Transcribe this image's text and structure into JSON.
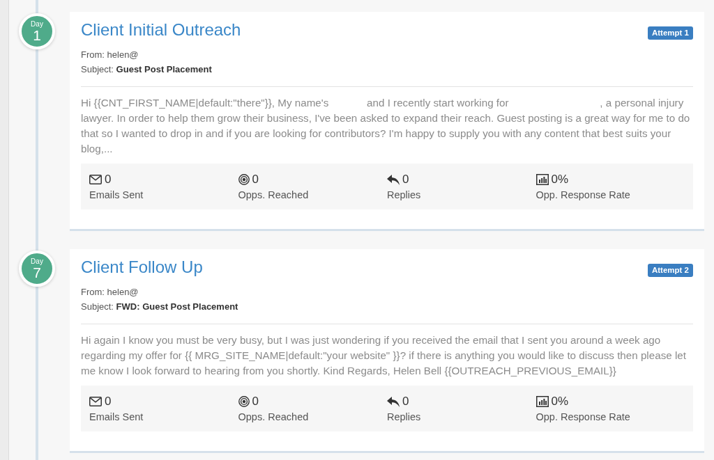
{
  "steps": [
    {
      "day_label": "Day",
      "day": "1",
      "title": "Client Initial Outreach",
      "badge": "Attempt 1",
      "from_line": "From: helen@",
      "subject_line": "Subject: **Guest Post Placement**",
      "body": "Hi {{CNT_FIRST_NAME|default:\"there\"}}, My name's             and I recently start working for                               , a personal injury lawyer. In order to help them grow their business, I've been asked to expand their reach. Guest posting is a great way for me to do that so I wanted to drop in and if you are looking for contributors? I'm happy to supply you with any content that best suits your blog,...",
      "stats": [
        {
          "kind": "envelope",
          "value": "0",
          "label": "Emails Sent"
        },
        {
          "kind": "target",
          "value": "0",
          "label": "Opps. Reached"
        },
        {
          "kind": "reply",
          "value": "0",
          "label": "Replies"
        },
        {
          "kind": "chart",
          "value": "0%",
          "label": "Opp. Response Rate"
        }
      ]
    },
    {
      "day_label": "Day",
      "day": "7",
      "title": "Client Follow Up",
      "badge": "Attempt 2",
      "from_line": "From: helen@",
      "subject_line": "Subject: **FWD: Guest Post Placement**",
      "body": "Hi again I know you must be very busy, but I was just wondering if you received the email that I sent you around a week ago regarding my offer for {{ MRG_SITE_NAME|default:\"your website\" }}? if there is anything you would like to discuss then please let me know I look forward to hearing from you shortly. Kind Regards, Helen Bell {{OUTREACH_PREVIOUS_EMAIL}}",
      "stats": [
        {
          "kind": "envelope",
          "value": "0",
          "label": "Emails Sent"
        },
        {
          "kind": "target",
          "value": "0",
          "label": "Opps. Reached"
        },
        {
          "kind": "reply",
          "value": "0",
          "label": "Replies"
        },
        {
          "kind": "chart",
          "value": "0%",
          "label": "Opp. Response Rate"
        }
      ]
    }
  ]
}
